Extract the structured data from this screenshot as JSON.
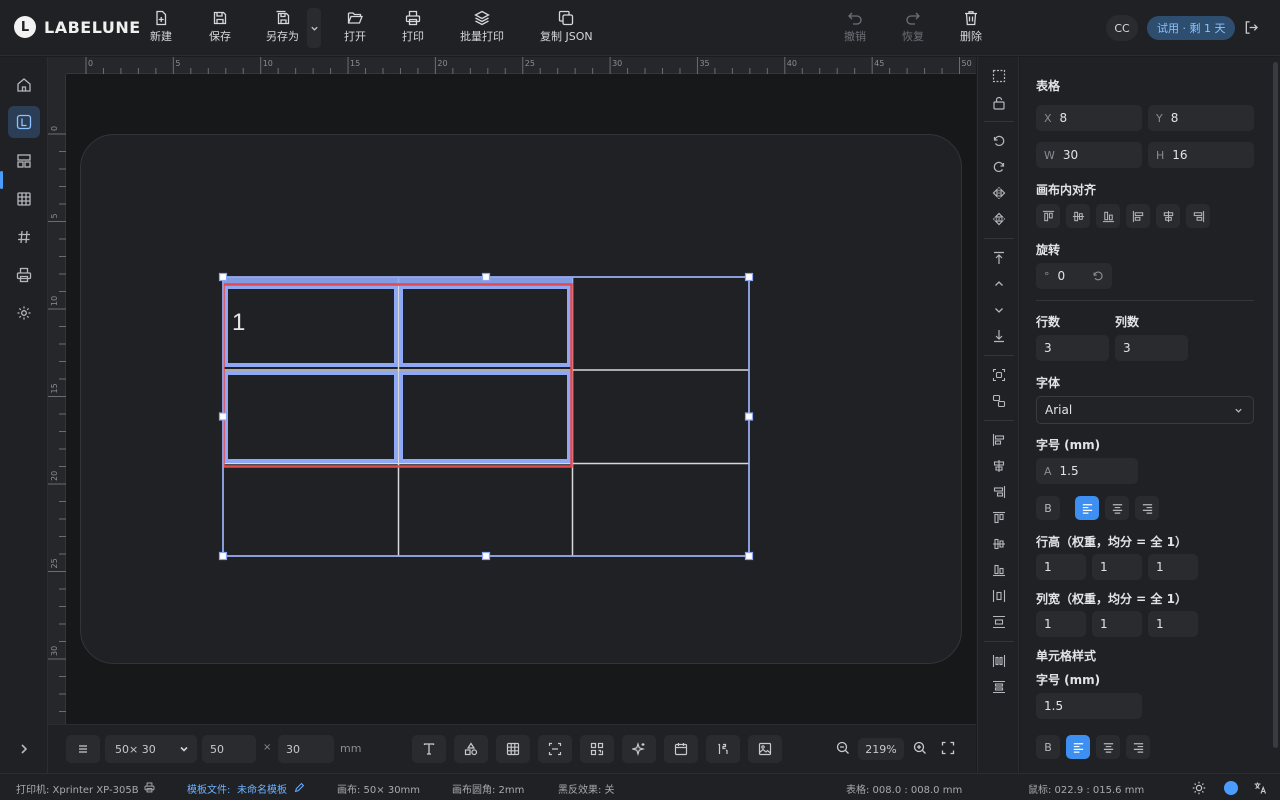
{
  "app": {
    "logo_letter": "L",
    "name": "LABELUNE"
  },
  "toolbar": {
    "new": "新建",
    "save": "保存",
    "save_as": "另存为",
    "open": "打开",
    "print": "打印",
    "batch_print": "批量打印",
    "copy_json": "复制 JSON",
    "undo": "撤销",
    "redo": "恢复",
    "delete": "删除"
  },
  "user": {
    "initials": "CC",
    "trial": "试用 · 剩 1 天"
  },
  "ruler": {
    "h_ticks": [
      "0",
      "5",
      "10",
      "15",
      "20",
      "25",
      "30",
      "35",
      "40",
      "45",
      "50"
    ],
    "v_ticks": [
      "0",
      "5",
      "10",
      "15",
      "20",
      "25",
      "30"
    ]
  },
  "canvas": {
    "cell_text": "1"
  },
  "panel": {
    "section_title": "表格",
    "x_prefix": "X",
    "x": "8",
    "y_prefix": "Y",
    "y": "8",
    "w_prefix": "W",
    "w": "30",
    "h_prefix": "H",
    "h": "16",
    "align_title": "画布内对齐",
    "rotate_title": "旋转",
    "rotate_prefix": "°",
    "rotate": "0",
    "rows_title": "行数",
    "rows": "3",
    "cols_title": "列数",
    "cols": "3",
    "font_title": "字体",
    "font_value": "Arial",
    "size_title": "字号 (mm)",
    "size_prefix": "A",
    "size": "1.5",
    "bold_label": "B",
    "row_height_title": "行高（权重，均分 = 全 1）",
    "row_heights": [
      "1",
      "1",
      "1"
    ],
    "col_width_title": "列宽（权重，均分 = 全 1）",
    "col_widths": [
      "1",
      "1",
      "1"
    ],
    "cell_style_title": "单元格样式",
    "cell_size_title": "字号 (mm)",
    "cell_size": "1.5"
  },
  "bottom": {
    "size_preset": "50× 30",
    "width": "50",
    "times": "×",
    "height": "30",
    "unit": "mm",
    "zoom": "219%"
  },
  "status": {
    "printer": "打印机: Xprinter XP-305B",
    "template_label": "模板文件:",
    "template_name": "未命名模板",
    "canvas_size": "画布: 50× 30mm",
    "canvas_radius": "画布圆角: 2mm",
    "invert": "黑反效果: 关",
    "table_pos": "表格: 008.0 : 008.0 mm",
    "mouse_pos": "鼠标: 022.9 : 015.6 mm"
  },
  "colors": {
    "accent": "#3d8ff2",
    "selection": "#8ea8f5",
    "cell_selection": "#e5484d",
    "trial_bg": "#2d4e6f"
  }
}
